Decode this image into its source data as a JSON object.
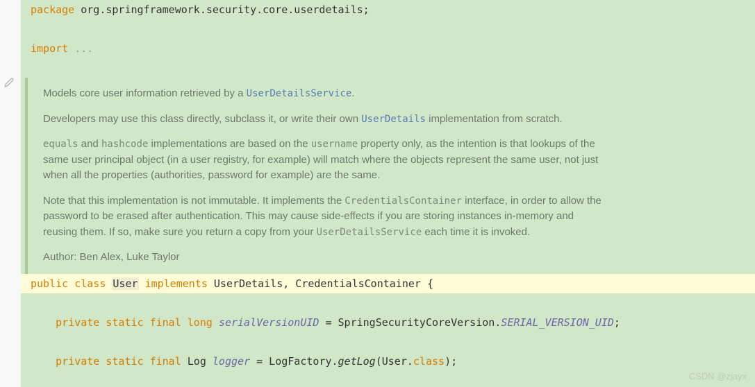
{
  "code": {
    "line1_package": "package",
    "line1_rest": " org.springframework.security.core.userdetails;",
    "line3_import": "import",
    "line3_rest": " ...",
    "class_public": "public",
    "class_class": "class",
    "class_user": "User",
    "class_implements": "implements",
    "class_rest": " UserDetails, CredentialsContainer {",
    "f1_private": "private",
    "f1_static": "static",
    "f1_final": "final",
    "f1_long": "long",
    "f1_name": "serialVersionUID",
    "f1_eq": " = SpringSecurityCoreVersion.",
    "f1_const": "SERIAL_VERSION_UID",
    "f1_semi": ";",
    "f2_private": "private",
    "f2_static": "static",
    "f2_final": "final",
    "f2_type": " Log ",
    "f2_name": "logger",
    "f2_eq": " = LogFactory.",
    "f2_method": "getLog",
    "f2_open": "(",
    "f2_user": "User",
    "f2_dot": ".",
    "f2_class": "class",
    "f2_close": ");"
  },
  "doc": {
    "p1a": "Models core user information retrieved by a ",
    "p1link": "UserDetailsService",
    "p1b": ".",
    "p2a": "Developers may use this class directly, subclass it, or write their own ",
    "p2link": "UserDetails",
    "p2b": " implementation from scratch.",
    "p3a": "equals",
    "p3b": " and ",
    "p3c": "hashcode",
    "p3d": " implementations are based on the ",
    "p3e": "username",
    "p3f": " property only, as the intention is that lookups of the same user principal object (in a user registry, for example) will match where the objects represent the same user, not just when all the properties (authorities, password for example) are the same.",
    "p4a": "Note that this implementation is not immutable. It implements the ",
    "p4b": "CredentialsContainer",
    "p4c": " interface, in order to allow the password to be erased after authentication. This may cause side-effects if you are storing instances in-memory and reusing them. If so, make sure you return a copy from your ",
    "p4d": "UserDetailsService",
    "p4e": " each time it is invoked.",
    "author": "Author: Ben Alex, Luke Taylor"
  },
  "watermark": "CSDN @zjayx"
}
